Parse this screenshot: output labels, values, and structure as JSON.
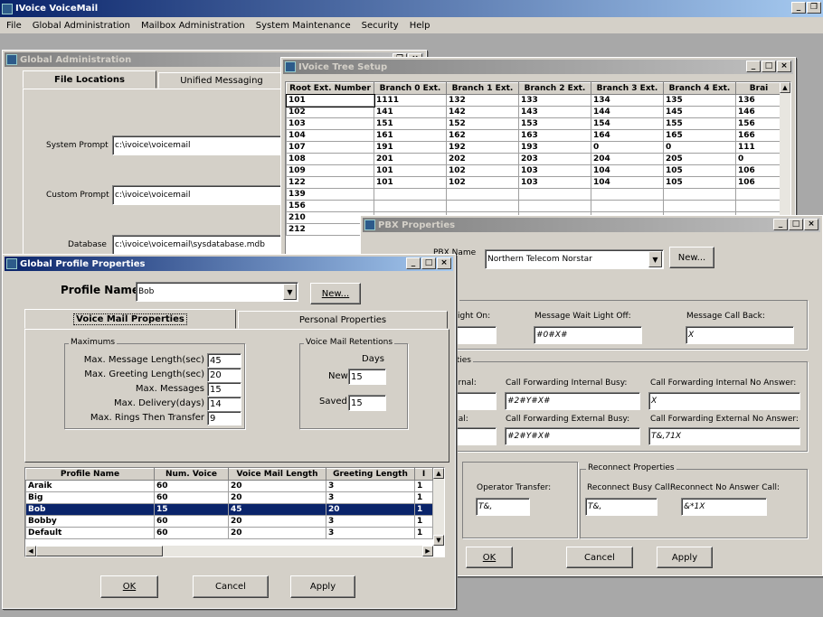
{
  "app": {
    "title": "IVoice VoiceMail"
  },
  "menu": [
    "File",
    "Global Administration",
    "Mailbox Administration",
    "System Maintenance",
    "Security",
    "Help"
  ],
  "global_admin": {
    "title": "Global Administration",
    "tabs": [
      "File Locations",
      "Unified Messaging"
    ],
    "system_prompt": {
      "label": "System Prompt",
      "value": "c:\\ivoice\\voicemail"
    },
    "custom_prompt": {
      "label": "Custom Prompt",
      "value": "c:\\ivoice\\voicemail"
    },
    "database": {
      "label": "Database",
      "value": "c:\\ivoice\\voicemail\\sysdatabase.mdb"
    }
  },
  "tree": {
    "title": "IVoice Tree Setup",
    "columns": [
      "Root Ext. Number",
      "Branch 0 Ext.",
      "Branch 1 Ext.",
      "Branch 2 Ext.",
      "Branch 3 Ext.",
      "Branch 4 Ext.",
      "Brai"
    ],
    "rows": [
      [
        "101",
        "1111",
        "132",
        "133",
        "134",
        "135",
        "136"
      ],
      [
        "102",
        "141",
        "142",
        "143",
        "144",
        "145",
        "146"
      ],
      [
        "103",
        "151",
        "152",
        "153",
        "154",
        "155",
        "156"
      ],
      [
        "104",
        "161",
        "162",
        "163",
        "164",
        "165",
        "166"
      ],
      [
        "107",
        "191",
        "192",
        "193",
        "0",
        "0",
        "111"
      ],
      [
        "108",
        "201",
        "202",
        "203",
        "204",
        "205",
        "0"
      ],
      [
        "109",
        "101",
        "102",
        "103",
        "104",
        "105",
        "106"
      ],
      [
        "122",
        "101",
        "102",
        "103",
        "104",
        "105",
        "106"
      ],
      [
        "139",
        "",
        "",
        "",
        "",
        "",
        ""
      ],
      [
        "156",
        "",
        "",
        "",
        "",
        "",
        ""
      ],
      [
        "210",
        "",
        "",
        "",
        "",
        "",
        ""
      ],
      [
        "212",
        "",
        "",
        "",
        "",
        "",
        ""
      ]
    ]
  },
  "pbx": {
    "title": "PBX Properties",
    "pbx_name_label": "PBX Name",
    "pbx_name_value": "Northern Telecom Norstar",
    "new_label": "New...",
    "light_on_label": "Light On:",
    "light_off_label": "Message Wait Light Off:",
    "light_off_value": "#0#X#",
    "call_back_label": "Message Call Back:",
    "call_back_value": "X",
    "group1_title_tail": "s",
    "group2_title_tail": "rties",
    "internal_label": "ernal:",
    "cf_internal_busy_label": "Call Forwarding Internal Busy:",
    "cf_internal_busy_value": "#2#Y#X#",
    "cf_internal_noans_label": "Call Forwarding Internal No Answer:",
    "cf_internal_noans_value": "X",
    "external_label": "nal:",
    "cf_external_busy_label": "Call Forwarding External Busy:",
    "cf_external_busy_value": "#2#Y#X#",
    "cf_external_noans_label": "Call Forwarding External No Answer:",
    "cf_external_noans_value": "T&,71X",
    "operator_transfer_label": "Operator Transfer:",
    "operator_transfer_value": "T&,",
    "reconnect_title": "Reconnect Properties",
    "reconnect_busy_label": "Reconnect Busy Call:",
    "reconnect_busy_value": "T&,",
    "reconnect_noans_label": "Reconnect No Answer Call:",
    "reconnect_noans_value": "&*1X",
    "ok": "OK",
    "cancel": "Cancel",
    "apply": "Apply"
  },
  "profile": {
    "title": "Global Profile Properties",
    "name_label": "Profile Name:",
    "name_value": "Bob",
    "new_label": "New...",
    "tabs": [
      "Voice Mail Properties",
      "Personal Properties"
    ],
    "maximums_title": "Maximums",
    "fields": [
      {
        "label": "Max. Message Length(sec)",
        "value": "45"
      },
      {
        "label": "Max. Greeting Length(sec)",
        "value": "20"
      },
      {
        "label": "Max. Messages",
        "value": "15"
      },
      {
        "label": "Max. Delivery(days)",
        "value": "14"
      },
      {
        "label": "Max. Rings Then Transfer",
        "value": "9"
      }
    ],
    "retention_title": "Voice Mail Retentions",
    "days_label": "Days",
    "new_ret_label": "New",
    "new_ret_value": "15",
    "saved_label": "Saved",
    "saved_value": "15",
    "columns": [
      "Profile Name",
      "Num. Voice",
      "Voice Mail Length",
      "Greeting Length",
      "I"
    ],
    "rows": [
      [
        "Araik",
        "60",
        "20",
        "3",
        "1"
      ],
      [
        "Big",
        "60",
        "20",
        "3",
        "1"
      ],
      [
        "Bob",
        "15",
        "45",
        "20",
        "1"
      ],
      [
        "Bobby",
        "60",
        "20",
        "3",
        "1"
      ],
      [
        "Default",
        "60",
        "20",
        "3",
        "1"
      ]
    ],
    "selected_row": 2,
    "ok": "OK",
    "cancel": "Cancel",
    "apply": "Apply"
  }
}
